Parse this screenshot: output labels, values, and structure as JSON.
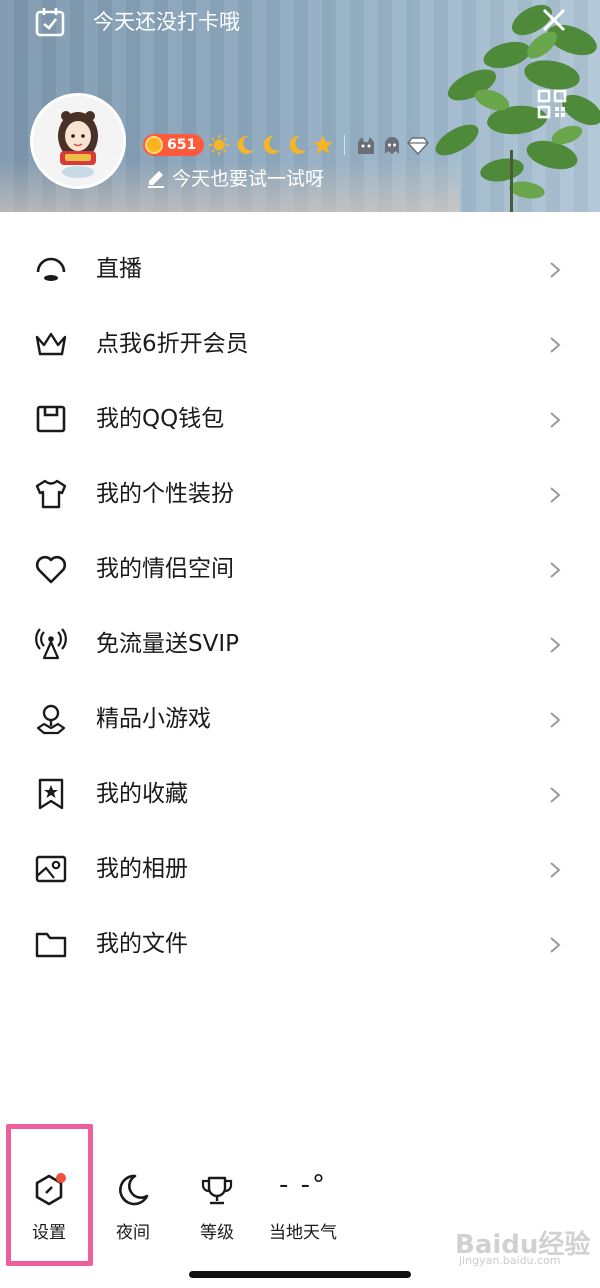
{
  "header": {
    "checkin_text": "今天还没打卡哦",
    "coin_count": "651",
    "signature": "今天也要试一试呀"
  },
  "menu": [
    {
      "label": "直播",
      "icon": "live-icon"
    },
    {
      "label": "点我6折开会员",
      "icon": "crown-icon"
    },
    {
      "label": "我的QQ钱包",
      "icon": "wallet-icon"
    },
    {
      "label": "我的个性装扮",
      "icon": "tshirt-icon"
    },
    {
      "label": "我的情侣空间",
      "icon": "heart-icon"
    },
    {
      "label": "免流量送SVIP",
      "icon": "signal-tower-icon"
    },
    {
      "label": "精品小游戏",
      "icon": "game-pin-icon"
    },
    {
      "label": "我的收藏",
      "icon": "bookmark-star-icon"
    },
    {
      "label": "我的相册",
      "icon": "album-icon"
    },
    {
      "label": "我的文件",
      "icon": "folder-icon"
    }
  ],
  "bottom": {
    "settings": "设置",
    "night": "夜间",
    "level": "等级",
    "weather_value": "- -°",
    "weather_label": "当地天气"
  },
  "watermark": {
    "main": "Baidu经验",
    "sub": "jingyan.baidu.com"
  },
  "colors": {
    "highlight_border": "#ef5f9b",
    "badge_dot": "#f2503c",
    "coin_pill": "#ff5a3c"
  }
}
